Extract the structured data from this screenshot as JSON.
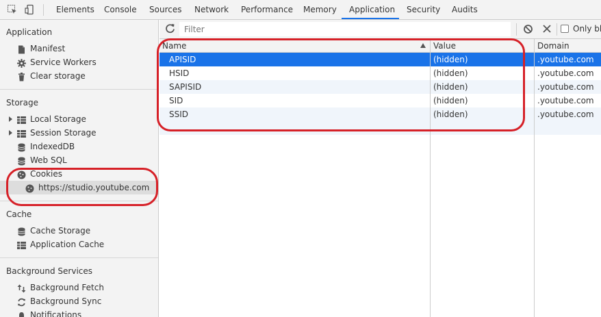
{
  "tabbar": {
    "tabs": [
      {
        "label": "Elements",
        "active": false
      },
      {
        "label": "Console",
        "active": false
      },
      {
        "label": "Sources",
        "active": false
      },
      {
        "label": "Network",
        "active": false
      },
      {
        "label": "Performance",
        "active": false
      },
      {
        "label": "Memory",
        "active": false
      },
      {
        "label": "Application",
        "active": true
      },
      {
        "label": "Security",
        "active": false
      },
      {
        "label": "Audits",
        "active": false
      }
    ]
  },
  "sidebar": {
    "application": {
      "title": "Application",
      "items": [
        {
          "label": "Manifest",
          "icon": "document-icon"
        },
        {
          "label": "Service Workers",
          "icon": "gear-icon"
        },
        {
          "label": "Clear storage",
          "icon": "trash-icon"
        }
      ]
    },
    "storage": {
      "title": "Storage",
      "items": [
        {
          "label": "Local Storage",
          "icon": "grid-icon"
        },
        {
          "label": "Session Storage",
          "icon": "grid-icon"
        },
        {
          "label": "IndexedDB",
          "icon": "database-icon"
        },
        {
          "label": "Web SQL",
          "icon": "database-icon"
        },
        {
          "label": "Cookies",
          "icon": "cookie-icon"
        },
        {
          "label": "https://studio.youtube.com",
          "icon": "cookie-icon"
        }
      ]
    },
    "cache": {
      "title": "Cache",
      "items": [
        {
          "label": "Cache Storage",
          "icon": "database-icon"
        },
        {
          "label": "Application Cache",
          "icon": "grid-icon"
        }
      ]
    },
    "background": {
      "title": "Background Services",
      "items": [
        {
          "label": "Background Fetch",
          "icon": "arrows-updown-icon"
        },
        {
          "label": "Background Sync",
          "icon": "sync-icon"
        },
        {
          "label": "Notifications",
          "icon": "bell-icon"
        }
      ]
    }
  },
  "toolbar": {
    "filter_placeholder": "Filter",
    "only_blocked_label": "Only blo"
  },
  "table": {
    "columns": [
      "Name",
      "Value",
      "Domain"
    ],
    "sort_column": "Name",
    "rows": [
      {
        "name": "APISID",
        "value": "(hidden)",
        "domain": ".youtube.com",
        "selected": true
      },
      {
        "name": "HSID",
        "value": "(hidden)",
        "domain": ".youtube.com",
        "selected": false
      },
      {
        "name": "SAPISID",
        "value": "(hidden)",
        "domain": ".youtube.com",
        "selected": false
      },
      {
        "name": "SID",
        "value": "(hidden)",
        "domain": ".youtube.com",
        "selected": false
      },
      {
        "name": "SSID",
        "value": "(hidden)",
        "domain": ".youtube.com",
        "selected": false
      }
    ]
  },
  "colors": {
    "accent": "#1a73e8",
    "annotation": "#d62027",
    "panel_bg": "#f3f3f3",
    "stripe": "#f0f5fb"
  }
}
